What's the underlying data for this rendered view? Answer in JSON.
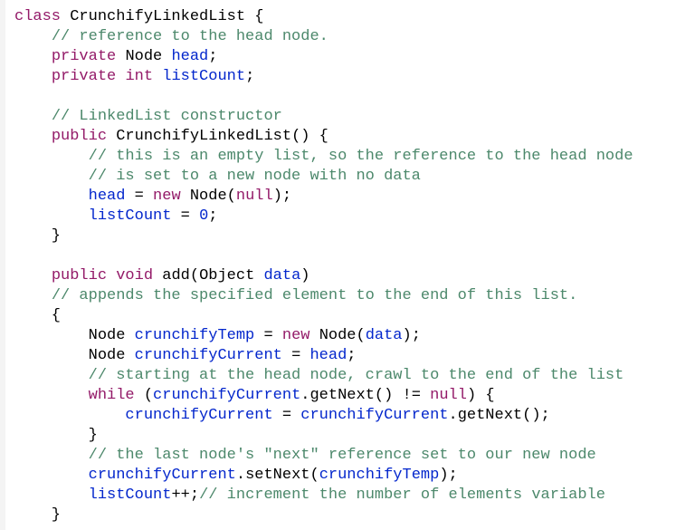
{
  "code": {
    "tokens": {
      "class": "class",
      "private": "private",
      "public": "public",
      "void": "void",
      "int": "int",
      "new": "new",
      "null": "null",
      "while": "while",
      "classname": "CrunchifyLinkedList",
      "node": "Node",
      "object": "Object",
      "head": "head",
      "listCount": "listCount",
      "crunchifyTemp": "crunchifyTemp",
      "crunchifyCurrent": "crunchifyCurrent",
      "data": "data",
      "add": "add",
      "getNext": "getNext",
      "setNext": "setNext",
      "zero": "0"
    },
    "comments": {
      "c1": "// reference to the head node.",
      "c2": "// LinkedList constructor",
      "c3": "// this is an empty list, so the reference to the head node",
      "c4": "// is set to a new node with no data",
      "c5": "// appends the specified element to the end of this list.",
      "c6": "// starting at the head node, crawl to the end of the list",
      "c7": "// the last node's \"next\" reference set to our new node",
      "c8": "// increment the number of elements variable"
    }
  }
}
